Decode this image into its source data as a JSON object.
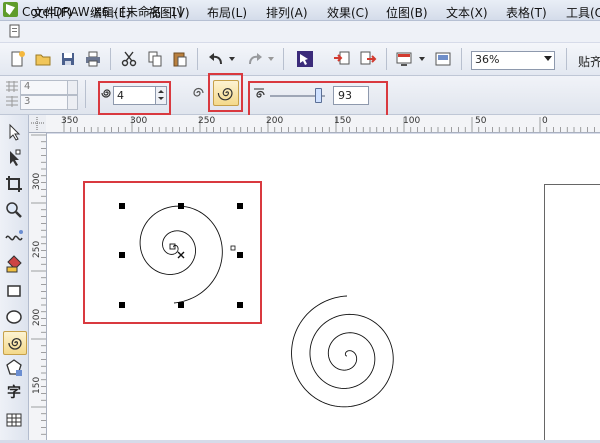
{
  "window": {
    "title": "CorelDRAW X6 - [未命名 -1]"
  },
  "menu": {
    "items": [
      "文件(F)",
      "编辑(E)",
      "视图(V)",
      "布局(L)",
      "排列(A)",
      "效果(C)",
      "位图(B)",
      "文本(X)",
      "表格(T)",
      "工具(O)"
    ]
  },
  "toolbar": {
    "zoom_value": "36%",
    "snap_label": "贴齐"
  },
  "propbar": {
    "columns_value": "4",
    "rows_value": "3",
    "revolutions_value": "4",
    "expansion_value": "93",
    "expansion_fraction": 0.93
  },
  "rulers": {
    "horizontal_labels": [
      "350",
      "300",
      "250",
      "200",
      "150",
      "100",
      "50",
      "0"
    ],
    "vertical_labels": [
      "300",
      "250",
      "200",
      "150"
    ]
  },
  "colors": {
    "highlight": "#d9393f",
    "selected_tool": "#f4d98a"
  },
  "icons": {
    "tools": [
      "pick-icon",
      "shape-icon",
      "crop-icon",
      "zoom-icon",
      "freehand-icon",
      "smart-fill-icon",
      "rectangle-icon",
      "ellipse-icon",
      "spiral-icon",
      "polygon-icon",
      "text-icon",
      "table-icon"
    ]
  }
}
